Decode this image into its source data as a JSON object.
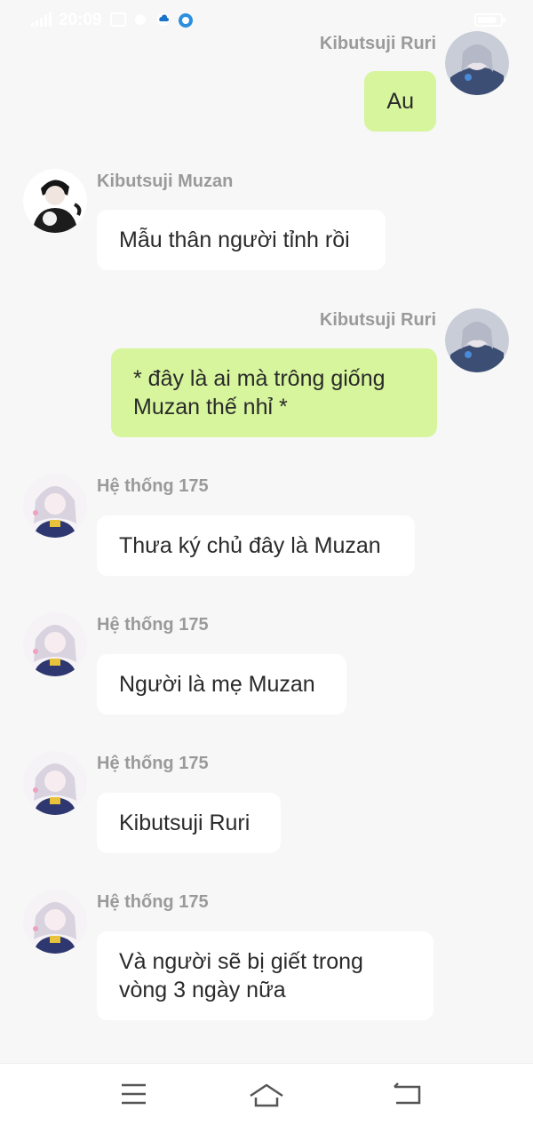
{
  "status_bar": {
    "time": "20:09",
    "accent": "#ffffff"
  },
  "chat": {
    "messages": [
      {
        "side": "right",
        "sender": "Kibutsuji Ruri",
        "text": "Au",
        "avatar": "ruri-avatar"
      },
      {
        "side": "left",
        "sender": "Kibutsuji Muzan",
        "text": "Mẫu thân người tỉnh rồi",
        "avatar": "muzan-avatar"
      },
      {
        "side": "right",
        "sender": "Kibutsuji Ruri",
        "text": "* đây là ai mà trông giống Muzan thế nhỉ *",
        "avatar": "ruri-avatar"
      },
      {
        "side": "left",
        "sender": "Hệ thống 175",
        "text": "Thưa ký chủ đây là Muzan",
        "avatar": "system-avatar"
      },
      {
        "side": "left",
        "sender": "Hệ thống 175",
        "text": "Người là mẹ Muzan",
        "avatar": "system-avatar"
      },
      {
        "side": "left",
        "sender": "Hệ thống 175",
        "text": "Kibutsuji Ruri",
        "avatar": "system-avatar"
      },
      {
        "side": "left",
        "sender": "Hệ thống 175",
        "text": "Và người sẽ bị giết trong vòng 3 ngày nữa",
        "avatar": "system-avatar"
      }
    ]
  },
  "colors": {
    "background": "#f7f7f7",
    "own_bubble": "#d6f59c",
    "other_bubble": "#ffffff",
    "name_text": "#9a9a9a"
  },
  "nav_bar": {
    "buttons": [
      "menu-icon",
      "home-icon",
      "back-icon"
    ]
  }
}
